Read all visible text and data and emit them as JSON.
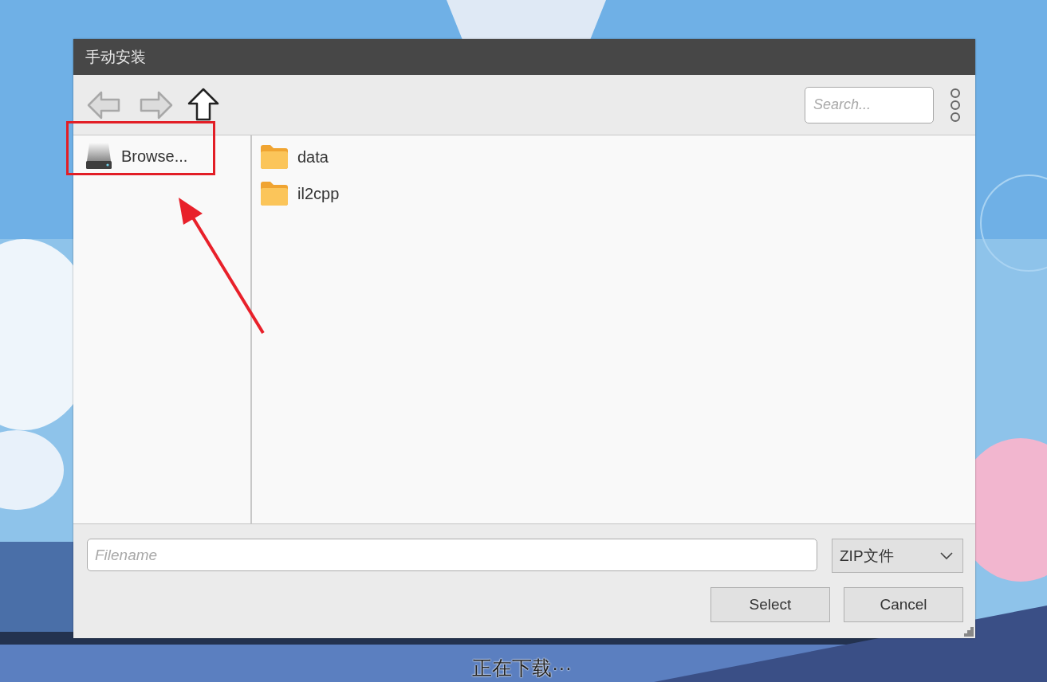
{
  "window": {
    "title": "手动安装"
  },
  "toolbar": {
    "buttons": [
      {
        "kind": "back",
        "disabled": true
      },
      {
        "kind": "forward",
        "disabled": true
      },
      {
        "kind": "up",
        "disabled": false
      }
    ],
    "search": {
      "placeholder": "Search..."
    }
  },
  "sidebar": {
    "items": [
      {
        "label": "Browse..."
      }
    ]
  },
  "files": [
    {
      "name": "data"
    },
    {
      "name": "il2cpp"
    }
  ],
  "filename": {
    "placeholder": "Filename"
  },
  "file_type": {
    "value": "ZIP文件"
  },
  "buttons": [
    "Select",
    "Cancel"
  ],
  "caption": "正在下载···"
}
